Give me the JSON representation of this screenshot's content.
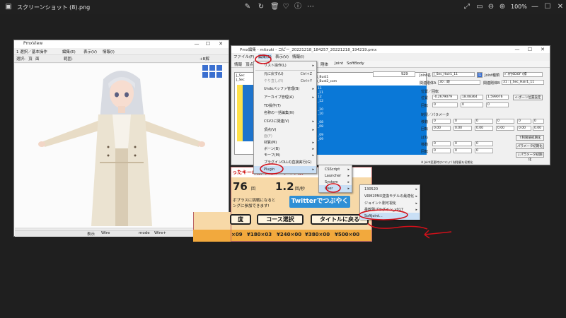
{
  "viewer": {
    "title": "スクリーンショット (8).png",
    "zoom": "100%"
  },
  "pmxview": {
    "title": "PmxView",
    "menu": [
      "1 選択／基本操作",
      "編集(E)",
      "表示(V)",
      "情報(I)"
    ],
    "toolbar": [
      "選択:",
      "頂",
      "面",
      "範囲:",
      "+B解"
    ],
    "status": [
      "表示",
      "Wire",
      "mode",
      "Wire+",
      "|"
    ]
  },
  "pmx": {
    "title": "Pmx編集 - mitsuki - コピー_20221218_184257_20221218_194219.pmx",
    "menu": [
      "ファイル(F)",
      "編集(E)",
      "表示(V)",
      "情報(I)"
    ],
    "tabs": [
      "情報",
      "頂点",
      "材質",
      "ボーン",
      "モーフ",
      "表示枠",
      "剛体",
      "Joint",
      "SoftBody"
    ],
    "list_rows": [
      "J_Sec",
      "J_Sec",
      "J_Sec",
      "J_Sec",
      "J_Sec",
      "J_Sec",
      "J_Sec",
      "J_Sec",
      "J_Sec",
      "J_Sec",
      "J_Sec",
      "J_Sec",
      "J_Sec",
      "J_Sec",
      "J_Sec"
    ],
    "list_names": [
      "R_Bust1",
      "R_Bust2_com",
      "11",
      "_11",
      "12",
      "_12",
      "_10",
      "_10",
      "_08",
      "_08",
      "_09",
      "_09",
      "_09",
      "_09",
      "_09"
    ],
    "count_value": "929",
    "joint_name_label": "Joint名",
    "joint_name_value": "J_Sec_Hair1_11",
    "joint_type_label": "Joint種類",
    "joint_type_value": "ﾊﾞﾈ付6DOF (標",
    "rigid_a_label": "関連剛体A",
    "rigid_a_value": "30 : 頭",
    "rigid_b_label": "関連剛体B",
    "rigid_b_value": "31 : J_Sec_Hair1_11",
    "pos_rot_label": "位置／回転",
    "pos_label": "位置",
    "pos_x": "-0.2679079",
    "pos_y": "18.08364",
    "pos_z": "1.599076",
    "rot_label": "回転",
    "rot_x": "0",
    "rot_y": "0",
    "rot_z": "0",
    "bone_pos_button": "<-ボーン位置設定",
    "limit_label": "制限／パラメータ",
    "move_label": "移動",
    "rotate_label": "回転",
    "spring_label": "ばね",
    "zero": "0",
    "zero_f": "0.00",
    "init_limit_button": "↑制限値初期化",
    "init_param_button": "パラメータ初期化",
    "param_button": "↓パラメータ初期化",
    "footer_note": "※ Joint変更時はｿﾌﾄｳｪｱ / 制限値を初期化"
  },
  "edit_menu": {
    "items": [
      {
        "label": "リスト操作(L)",
        "shortcut": "",
        "arrow": true,
        "disabled": false
      },
      {
        "label": "元に戻す(U)",
        "shortcut": "Ctrl+Z",
        "arrow": false,
        "disabled": false
      },
      {
        "label": "やり直し(R)",
        "shortcut": "Ctrl+Y",
        "arrow": false,
        "disabled": true
      },
      {
        "label": "Undoバッファ管理(B)",
        "shortcut": "",
        "arrow": true,
        "disabled": false
      },
      {
        "label": "アーカイブ管理(A)",
        "shortcut": "",
        "arrow": true,
        "disabled": false
      },
      {
        "label": "TD操作(T)",
        "shortcut": "",
        "arrow": false,
        "disabled": false
      },
      {
        "label": "名称の一括編集(N)",
        "shortcut": "",
        "arrow": false,
        "disabled": false
      },
      {
        "label": "CSV2に関連(V)",
        "shortcut": "",
        "arrow": true,
        "disabled": false
      },
      {
        "label": "頂点(V)",
        "shortcut": "",
        "arrow": true,
        "disabled": false
      },
      {
        "label": "面(F)",
        "shortcut": "",
        "arrow": false,
        "disabled": true
      },
      {
        "label": "材質(M)",
        "shortcut": "",
        "arrow": true,
        "disabled": false
      },
      {
        "label": "ボーン(B)",
        "shortcut": "",
        "arrow": true,
        "disabled": false
      },
      {
        "label": "モーフ(M)",
        "shortcut": "",
        "arrow": true,
        "disabled": false
      },
      {
        "label": "プラグインDLLの直接実行(G)",
        "shortcut": "",
        "arrow": false,
        "disabled": false
      },
      {
        "label": "Plugin",
        "shortcut": "",
        "arrow": true,
        "disabled": false
      }
    ]
  },
  "plugin_menu": {
    "items": [
      "CSScript",
      "Launcher",
      "System",
      "User"
    ]
  },
  "user_menu": {
    "items": [
      "130520",
      "VRM2PMX変換モデルの最適化",
      "ジョイント剛可視化",
      "柔軟剛プラグイン_v017",
      "SoftJoint..."
    ]
  },
  "game": {
    "header": "ったキーの数 平均キータイプ数",
    "count": "76",
    "count_unit": "回",
    "speed": "1.2",
    "speed_unit": "回/秒",
    "hint_left": "ボプラスに挑戦になると",
    "hint_left2": "ングに参加できます!",
    "twitter_button": "Twitterでつぶやく",
    "btn_left": "度",
    "btn_course": "コース選択",
    "btn_title": "タイトルに戻る",
    "prices": [
      "×09",
      "¥180×03",
      "¥240×00",
      "¥380×00",
      "¥500×00"
    ]
  },
  "colors": {
    "accent_red": "#d1101a",
    "selection": "#1e74cc"
  }
}
